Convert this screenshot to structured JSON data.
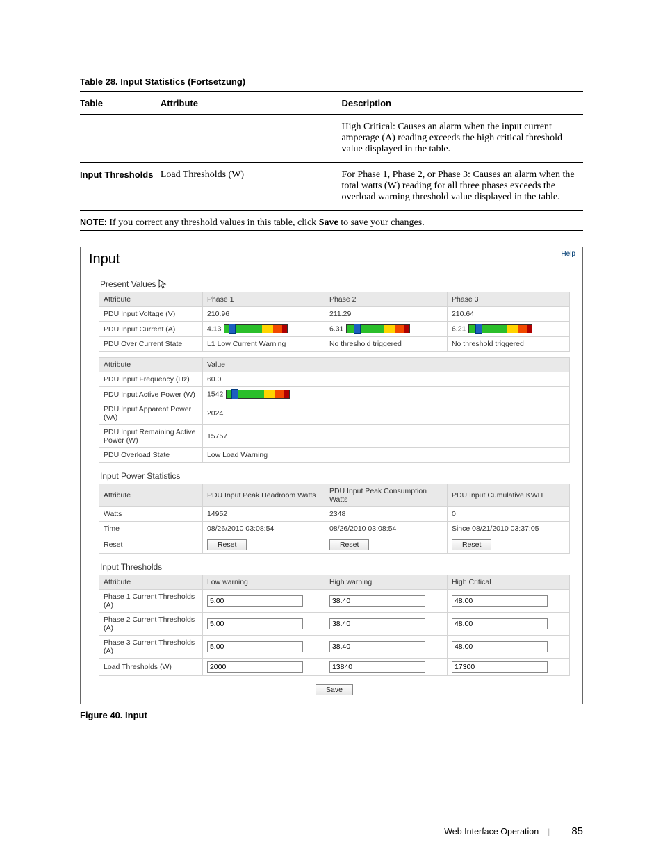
{
  "doc": {
    "table_caption": "Table 28. Input Statistics (Fortsetzung)",
    "headers": {
      "table": "Table",
      "attribute": "Attribute",
      "description": "Description"
    },
    "row1": {
      "desc": "High Critical: Causes an alarm when the input current amperage (A) reading exceeds the high critical threshold value displayed in the table."
    },
    "row2": {
      "table": "Input Thresholds",
      "attribute": "Load Thresholds (W)",
      "desc": "For Phase 1, Phase 2, or Phase 3: Causes an alarm when the total watts (W) reading for all three phases exceeds the overload warning threshold value displayed in the table."
    },
    "note_label": "NOTE:",
    "note_text_a": "  If you correct any threshold values in this table, click ",
    "note_bold": "Save",
    "note_text_b": " to save your changes.",
    "figure_caption": "Figure 40. Input",
    "footer_section": "Web Interface Operation",
    "footer_page": "85"
  },
  "shot": {
    "title": "Input",
    "help": "Help",
    "present_values": "Present Values",
    "pv_headers": {
      "attr": "Attribute",
      "p1": "Phase 1",
      "p2": "Phase 2",
      "p3": "Phase 3"
    },
    "pv_rows": {
      "voltage": {
        "label": "PDU Input Voltage (V)",
        "p1": "210.96",
        "p2": "211.29",
        "p3": "210.64"
      },
      "current": {
        "label": "PDU Input Current (A)",
        "p1": "4.13",
        "p2": "6.31",
        "p3": "6.21"
      },
      "oc_state": {
        "label": "PDU Over Current State",
        "p1": "L1 Low Current Warning",
        "p2": "No threshold triggered",
        "p3": "No threshold triggered"
      }
    },
    "val_headers": {
      "attr": "Attribute",
      "val": "Value"
    },
    "val_rows": {
      "freq": {
        "label": "PDU Input Frequency (Hz)",
        "val": "60.0"
      },
      "active": {
        "label": "PDU Input Active Power (W)",
        "val": "1542"
      },
      "apparent": {
        "label": "PDU Input Apparent Power (VA)",
        "val": "2024"
      },
      "remaining": {
        "label": "PDU Input Remaining Active Power (W)",
        "val": "15757"
      },
      "overload": {
        "label": "PDU Overload State",
        "val": "Low Load Warning"
      }
    },
    "stats_section": "Input Power Statistics",
    "stats_headers": {
      "attr": "Attribute",
      "c1": "PDU Input Peak Headroom Watts",
      "c2": "PDU Input Peak Consumption Watts",
      "c3": "PDU Input Cumulative KWH"
    },
    "stats_rows": {
      "watts": {
        "label": "Watts",
        "c1": "14952",
        "c2": "2348",
        "c3": "0"
      },
      "time": {
        "label": "Time",
        "c1": "08/26/2010 03:08:54",
        "c2": "08/26/2010 03:08:54",
        "c3": "Since 08/21/2010 03:37:05"
      },
      "reset": {
        "label": "Reset",
        "btn": "Reset"
      }
    },
    "thresh_section": "Input Thresholds",
    "thresh_headers": {
      "attr": "Attribute",
      "low": "Low warning",
      "high": "High warning",
      "crit": "High Critical"
    },
    "thresh_rows": {
      "p1": {
        "label": "Phase 1 Current Thresholds (A)",
        "low": "5.00",
        "high": "38.40",
        "crit": "48.00"
      },
      "p2": {
        "label": "Phase 2 Current Thresholds (A)",
        "low": "5.00",
        "high": "38.40",
        "crit": "48.00"
      },
      "p3": {
        "label": "Phase 3 Current Thresholds (A)",
        "low": "5.00",
        "high": "38.40",
        "crit": "48.00"
      },
      "load": {
        "label": "Load Thresholds (W)",
        "low": "2000",
        "high": "13840",
        "crit": "17300"
      }
    },
    "save": "Save"
  },
  "chart_data": [
    {
      "type": "bar",
      "title": "PDU Input Current Phase 1",
      "categories": [
        "A"
      ],
      "values": [
        4.13
      ],
      "ylim": [
        0,
        48
      ]
    },
    {
      "type": "bar",
      "title": "PDU Input Current Phase 2",
      "categories": [
        "A"
      ],
      "values": [
        6.31
      ],
      "ylim": [
        0,
        48
      ]
    },
    {
      "type": "bar",
      "title": "PDU Input Current Phase 3",
      "categories": [
        "A"
      ],
      "values": [
        6.21
      ],
      "ylim": [
        0,
        48
      ]
    },
    {
      "type": "bar",
      "title": "PDU Input Active Power",
      "categories": [
        "W"
      ],
      "values": [
        1542
      ],
      "ylim": [
        0,
        17300
      ]
    }
  ]
}
